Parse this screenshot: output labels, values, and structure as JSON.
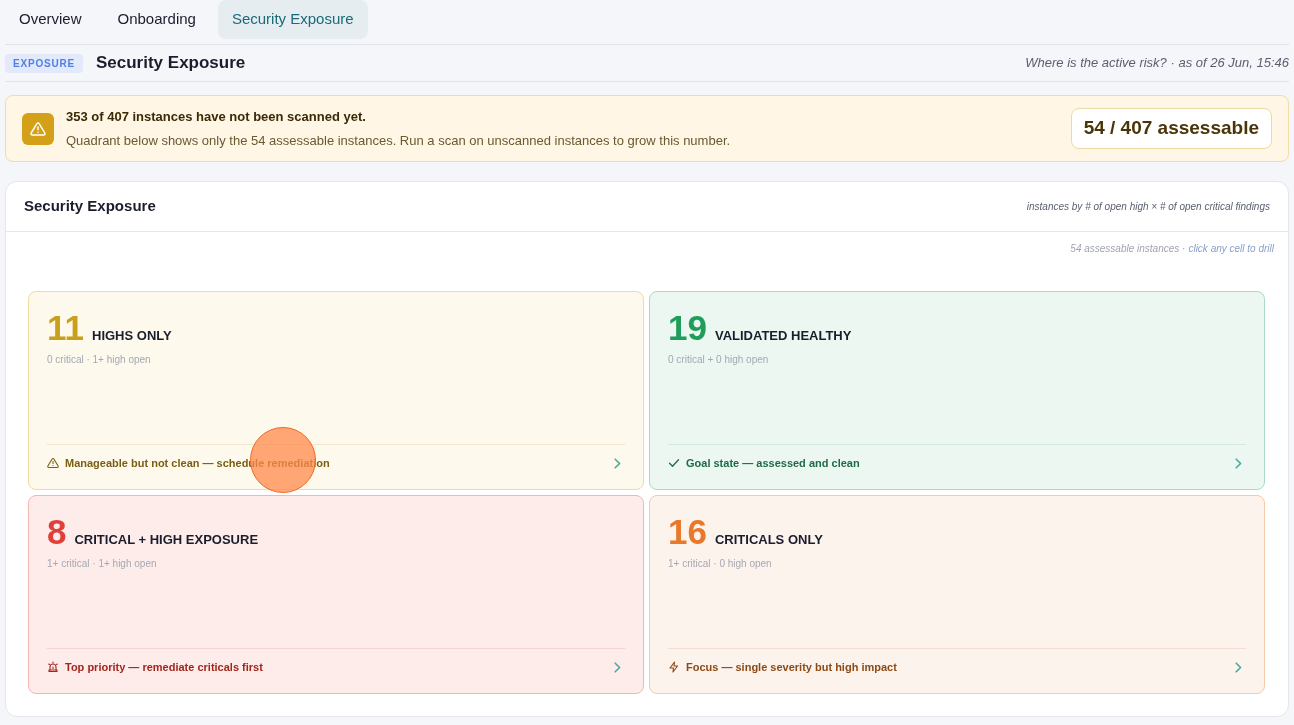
{
  "tabs": [
    {
      "label": "Overview",
      "selected": false
    },
    {
      "label": "Onboarding",
      "selected": false
    },
    {
      "label": "Security Exposure",
      "selected": true
    }
  ],
  "header": {
    "badge": "EXPOSURE",
    "title": "Security Exposure",
    "subtitle": "Where is the active risk? · as of 26 Jun, 15:46"
  },
  "alert": {
    "title": "353 of 407 instances have not been scanned yet.",
    "message": "Quadrant below shows only the 54 assessable instances. Run a scan on unscanned instances to grow this number.",
    "count": "54 / 407 assessable"
  },
  "panel": {
    "title": "Security Exposure",
    "axis_note": "instances by # of open high × # of open critical findings",
    "summary": "54 assessable instances ·",
    "action": "click any cell to drill",
    "quadrants": [
      {
        "kind": "warning",
        "color": "#c9a01c",
        "count": "11",
        "label": "HIGHS ONLY",
        "criteria": "0 critical · 1+ high open",
        "note": "Manageable but not clean — schedule remediation"
      },
      {
        "kind": "check",
        "color": "#1e9e5a",
        "count": "19",
        "label": "VALIDATED HEALTHY",
        "criteria": "0 critical + 0 high open",
        "note": "Goal state — assessed and clean"
      },
      {
        "kind": "alarm",
        "color": "#e0403a",
        "count": "8",
        "label": "CRITICAL + HIGH EXPOSURE",
        "criteria": "1+ critical · 1+ high open",
        "note": "Top priority — remediate criticals first"
      },
      {
        "kind": "bolt",
        "color": "#e8782a",
        "count": "16",
        "label": "CRITICALS ONLY",
        "criteria": "1+ critical · 0 high open",
        "note": "Focus — single severity but high impact"
      }
    ]
  }
}
